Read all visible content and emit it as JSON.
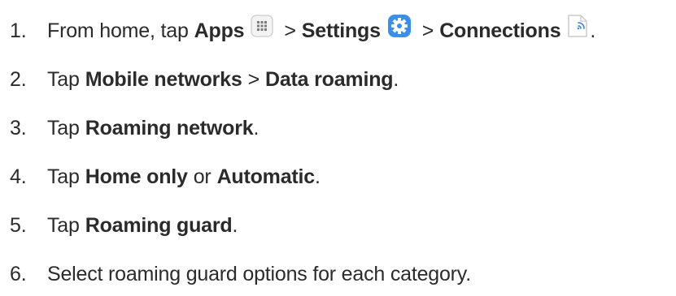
{
  "steps": [
    {
      "number": "1.",
      "prefix": "From home, tap",
      "apps": "Apps",
      "sep1": ">",
      "settings": "Settings",
      "sep2": ">",
      "connections": "Connections",
      "end": "."
    },
    {
      "number": "2.",
      "prefix": "Tap",
      "b1": "Mobile networks",
      "sep": ">",
      "b2": "Data roaming",
      "end": "."
    },
    {
      "number": "3.",
      "prefix": "Tap",
      "b1": "Roaming network",
      "end": "."
    },
    {
      "number": "4.",
      "prefix": "Tap",
      "b1": "Home only",
      "mid": "or",
      "b2": "Automatic",
      "end": "."
    },
    {
      "number": "5.",
      "prefix": "Tap",
      "b1": "Roaming guard",
      "end": "."
    },
    {
      "number": "6.",
      "text": "Select roaming guard options for each category."
    }
  ],
  "icons": {
    "apps": "apps-grid-icon",
    "settings": "settings-gear-icon",
    "connections": "connections-wifi-icon"
  },
  "colors": {
    "text": "#2b2b2b",
    "settings_blue": "#3b8fe8",
    "apps_grey": "#8c8c8c",
    "connections_blue": "#4a90e2"
  }
}
